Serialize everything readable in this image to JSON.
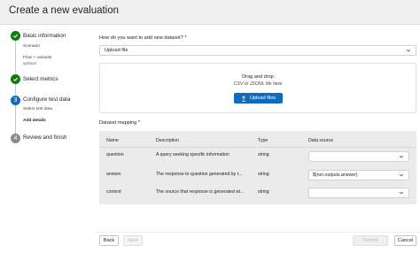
{
  "dialog": {
    "title": "Create a new evaluation"
  },
  "stepper": {
    "steps": [
      {
        "label": "Basic information",
        "status": "done",
        "number": "1"
      },
      {
        "label": "Select metrics",
        "status": "done",
        "number": "2"
      },
      {
        "label": "Configure test data",
        "status": "current",
        "number": "3"
      },
      {
        "label": "Review and finish",
        "status": "pending",
        "number": "4"
      }
    ],
    "substeps": {
      "scenario": "Scenario",
      "flow_variants": "Flow + variants",
      "optional": "optional",
      "select_test_data": "Select test data",
      "add_details": "Add details"
    }
  },
  "form": {
    "question_label": "How do you want to add new dataset? *",
    "dataset_method": "Upload file",
    "dropzone": {
      "title": "Drag and drop",
      "note": "CSV or JSONL file here",
      "upload_label": "Upload files"
    },
    "mapping_label": "Dataset mapping *",
    "mapping": {
      "headers": {
        "name": "Name",
        "description": "Description",
        "type": "Type",
        "source": "Data source"
      },
      "rows": [
        {
          "name": "question",
          "description": "A query seeking specific information",
          "type": "string",
          "source": ""
        },
        {
          "name": "answer",
          "description": "The response to question generated by t...",
          "type": "string",
          "source": "${run.outputs.answer}"
        },
        {
          "name": "context",
          "description": "The source that response is generated wi...",
          "type": "string",
          "source": ""
        }
      ]
    }
  },
  "footer": {
    "back": "Back",
    "next": "Next",
    "submit": "Submit",
    "cancel": "Cancel"
  },
  "colors": {
    "done": "#107c10",
    "current": "#0f6cbd",
    "pending": "#8a8a8a",
    "primary": "#0f6cbd"
  },
  "icons": {
    "done": "checkmark-icon",
    "upload": "upload-icon",
    "dropdown": "chevron-down-icon"
  }
}
